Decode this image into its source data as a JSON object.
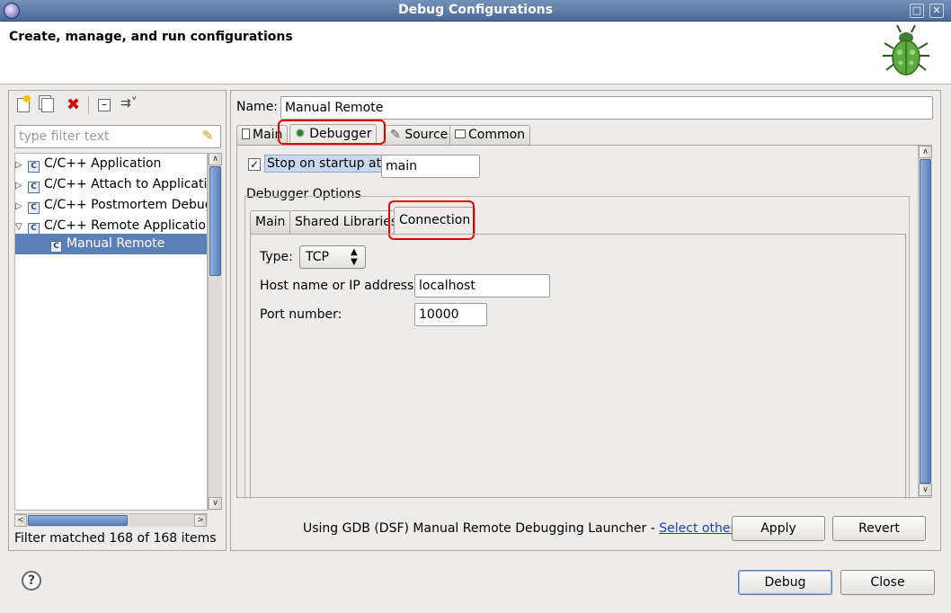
{
  "window": {
    "title": "Debug Configurations",
    "header_title": "Create, manage, and run configurations"
  },
  "left": {
    "filter_placeholder": "type filter text",
    "tree": [
      {
        "label": "C/C++ Application"
      },
      {
        "label": "C/C++ Attach to Applicatic"
      },
      {
        "label": "C/C++ Postmortem Debug"
      },
      {
        "label": "C/C++ Remote Application"
      },
      {
        "label": "Manual Remote"
      }
    ],
    "status": "Filter matched 168 of 168 items"
  },
  "right": {
    "name_label": "Name:",
    "name_value": "Manual Remote",
    "tabs": [
      {
        "label": "Main"
      },
      {
        "label": "Debugger"
      },
      {
        "label": "Source"
      },
      {
        "label": "Common"
      }
    ],
    "stop_on_startup_label": "Stop on startup at:",
    "stop_on_startup_value": "main",
    "debugger_options_label": "Debugger Options",
    "inner_tabs": [
      {
        "label": "Main"
      },
      {
        "label": "Shared Libraries"
      },
      {
        "label": "Connection"
      }
    ],
    "type_label": "Type:",
    "type_value": "TCP",
    "host_label": "Host name or IP address:",
    "host_value": "localhost",
    "port_label": "Port number:",
    "port_value": "10000",
    "launcher_text": "Using GDB (DSF) Manual Remote Debugging Launcher - ",
    "launcher_link": "Select other...",
    "apply_label": "Apply",
    "revert_label": "Revert"
  },
  "footer": {
    "debug_label": "Debug",
    "close_label": "Close",
    "help_icon": "?"
  },
  "colors": {
    "titlebar": "#5a78a6",
    "selection": "#5b80b8",
    "highlight_ring": "#e00000"
  }
}
